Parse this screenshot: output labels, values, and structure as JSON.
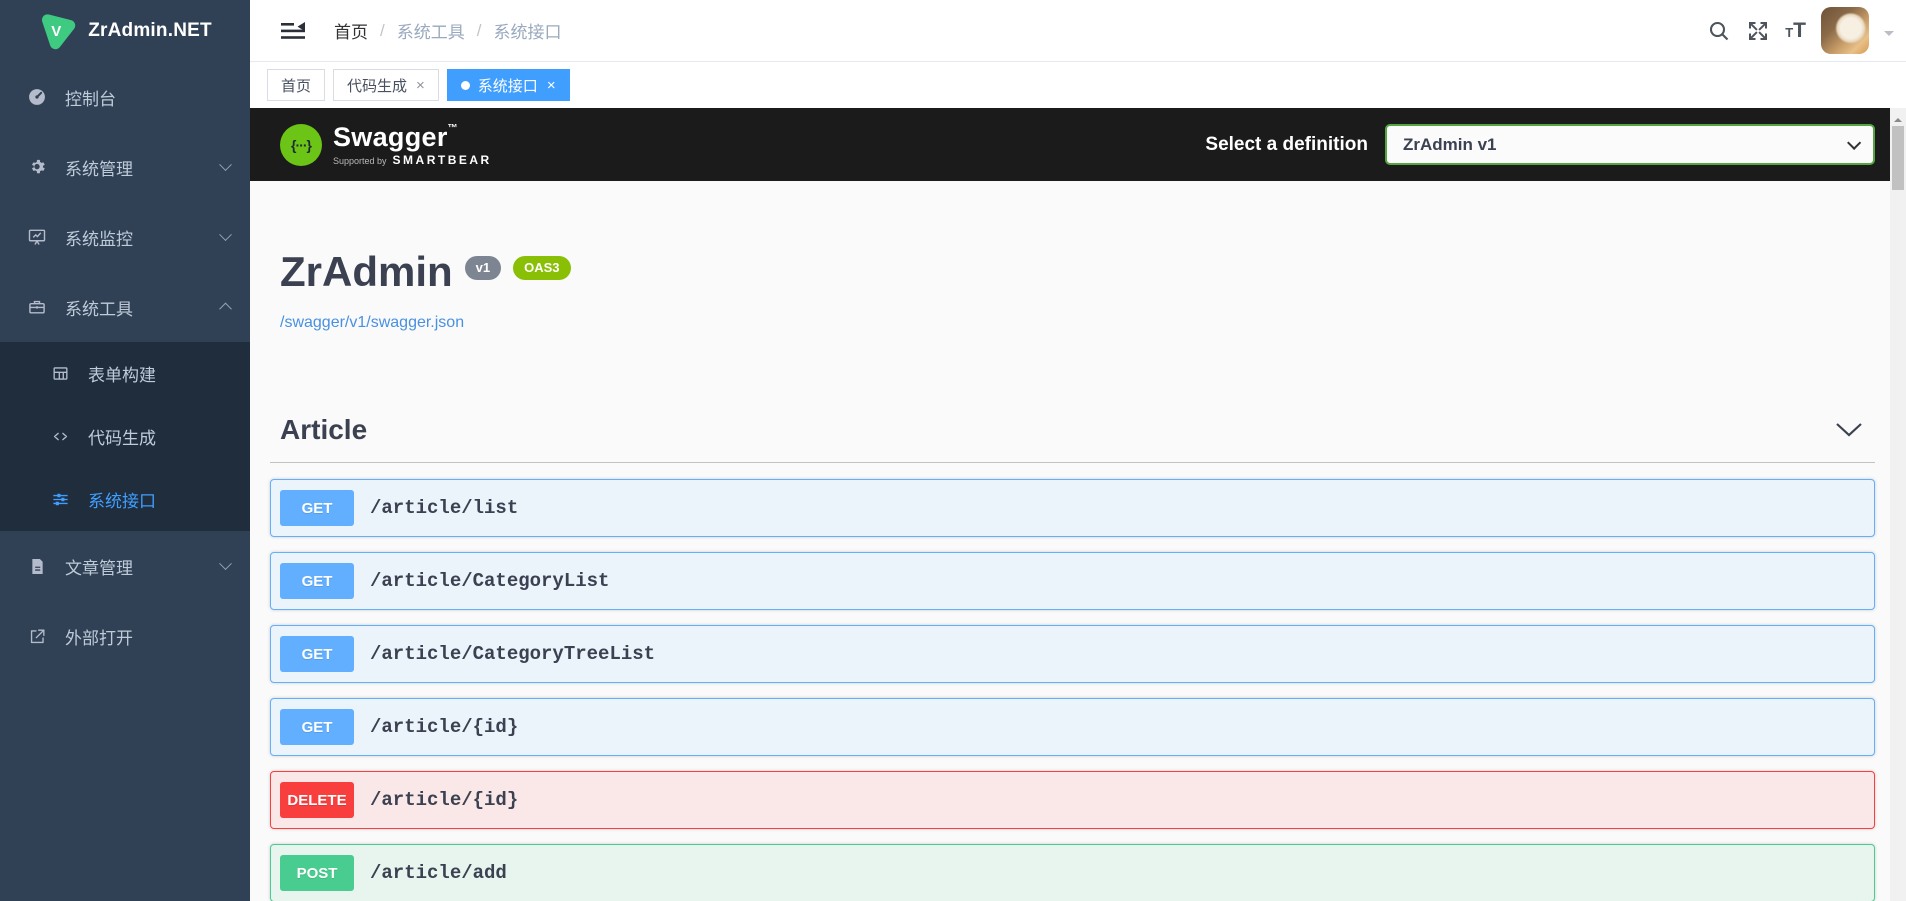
{
  "app": {
    "name": "ZrAdmin.NET",
    "logo_letter": "V"
  },
  "sidebar": {
    "items": [
      {
        "label": "控制台"
      },
      {
        "label": "系统管理"
      },
      {
        "label": "系统监控"
      },
      {
        "label": "系统工具"
      },
      {
        "label": "表单构建"
      },
      {
        "label": "代码生成"
      },
      {
        "label": "系统接口"
      },
      {
        "label": "文章管理"
      },
      {
        "label": "外部打开"
      }
    ]
  },
  "breadcrumb": {
    "sep": "/",
    "items": [
      {
        "label": "首页"
      },
      {
        "label": "系统工具"
      },
      {
        "label": "系统接口"
      }
    ]
  },
  "tabs": {
    "close_glyph": "×",
    "items": [
      {
        "label": "首页"
      },
      {
        "label": "代码生成"
      },
      {
        "label": "系统接口"
      }
    ]
  },
  "header_icons": {
    "font_small": "T",
    "font_large": "T"
  },
  "swagger": {
    "logo_text": "Swagger",
    "logo_tm": "™",
    "logo_braces": "{···}",
    "supported_by": "Supported by",
    "smartbear": "SMARTBEAR",
    "select_label": "Select a definition",
    "selected_definition": "ZrAdmin v1",
    "api_title": "ZrAdmin",
    "version_badge": "v1",
    "oas_badge": "OAS3",
    "spec_url": "/swagger/v1/swagger.json",
    "section_title": "Article",
    "endpoints": [
      {
        "method": "GET",
        "path": "/article/list"
      },
      {
        "method": "GET",
        "path": "/article/CategoryList"
      },
      {
        "method": "GET",
        "path": "/article/CategoryTreeList"
      },
      {
        "method": "GET",
        "path": "/article/{id}"
      },
      {
        "method": "DELETE",
        "path": "/article/{id}"
      },
      {
        "method": "POST",
        "path": "/article/add"
      }
    ]
  },
  "colors": {
    "accent": "#409eff",
    "sidebar_bg": "#304156",
    "submenu_bg": "#1f2d3d",
    "swagger_bar": "#1b1b1b",
    "get": "#61affe",
    "post": "#49cc90",
    "delete": "#f93e3e",
    "oas_badge": "#89bf04",
    "version_badge": "#7d8492",
    "link": "#4990e2",
    "select_border": "#55a545",
    "logo_green": "#3fca81",
    "swagger_green": "#6cc417"
  }
}
